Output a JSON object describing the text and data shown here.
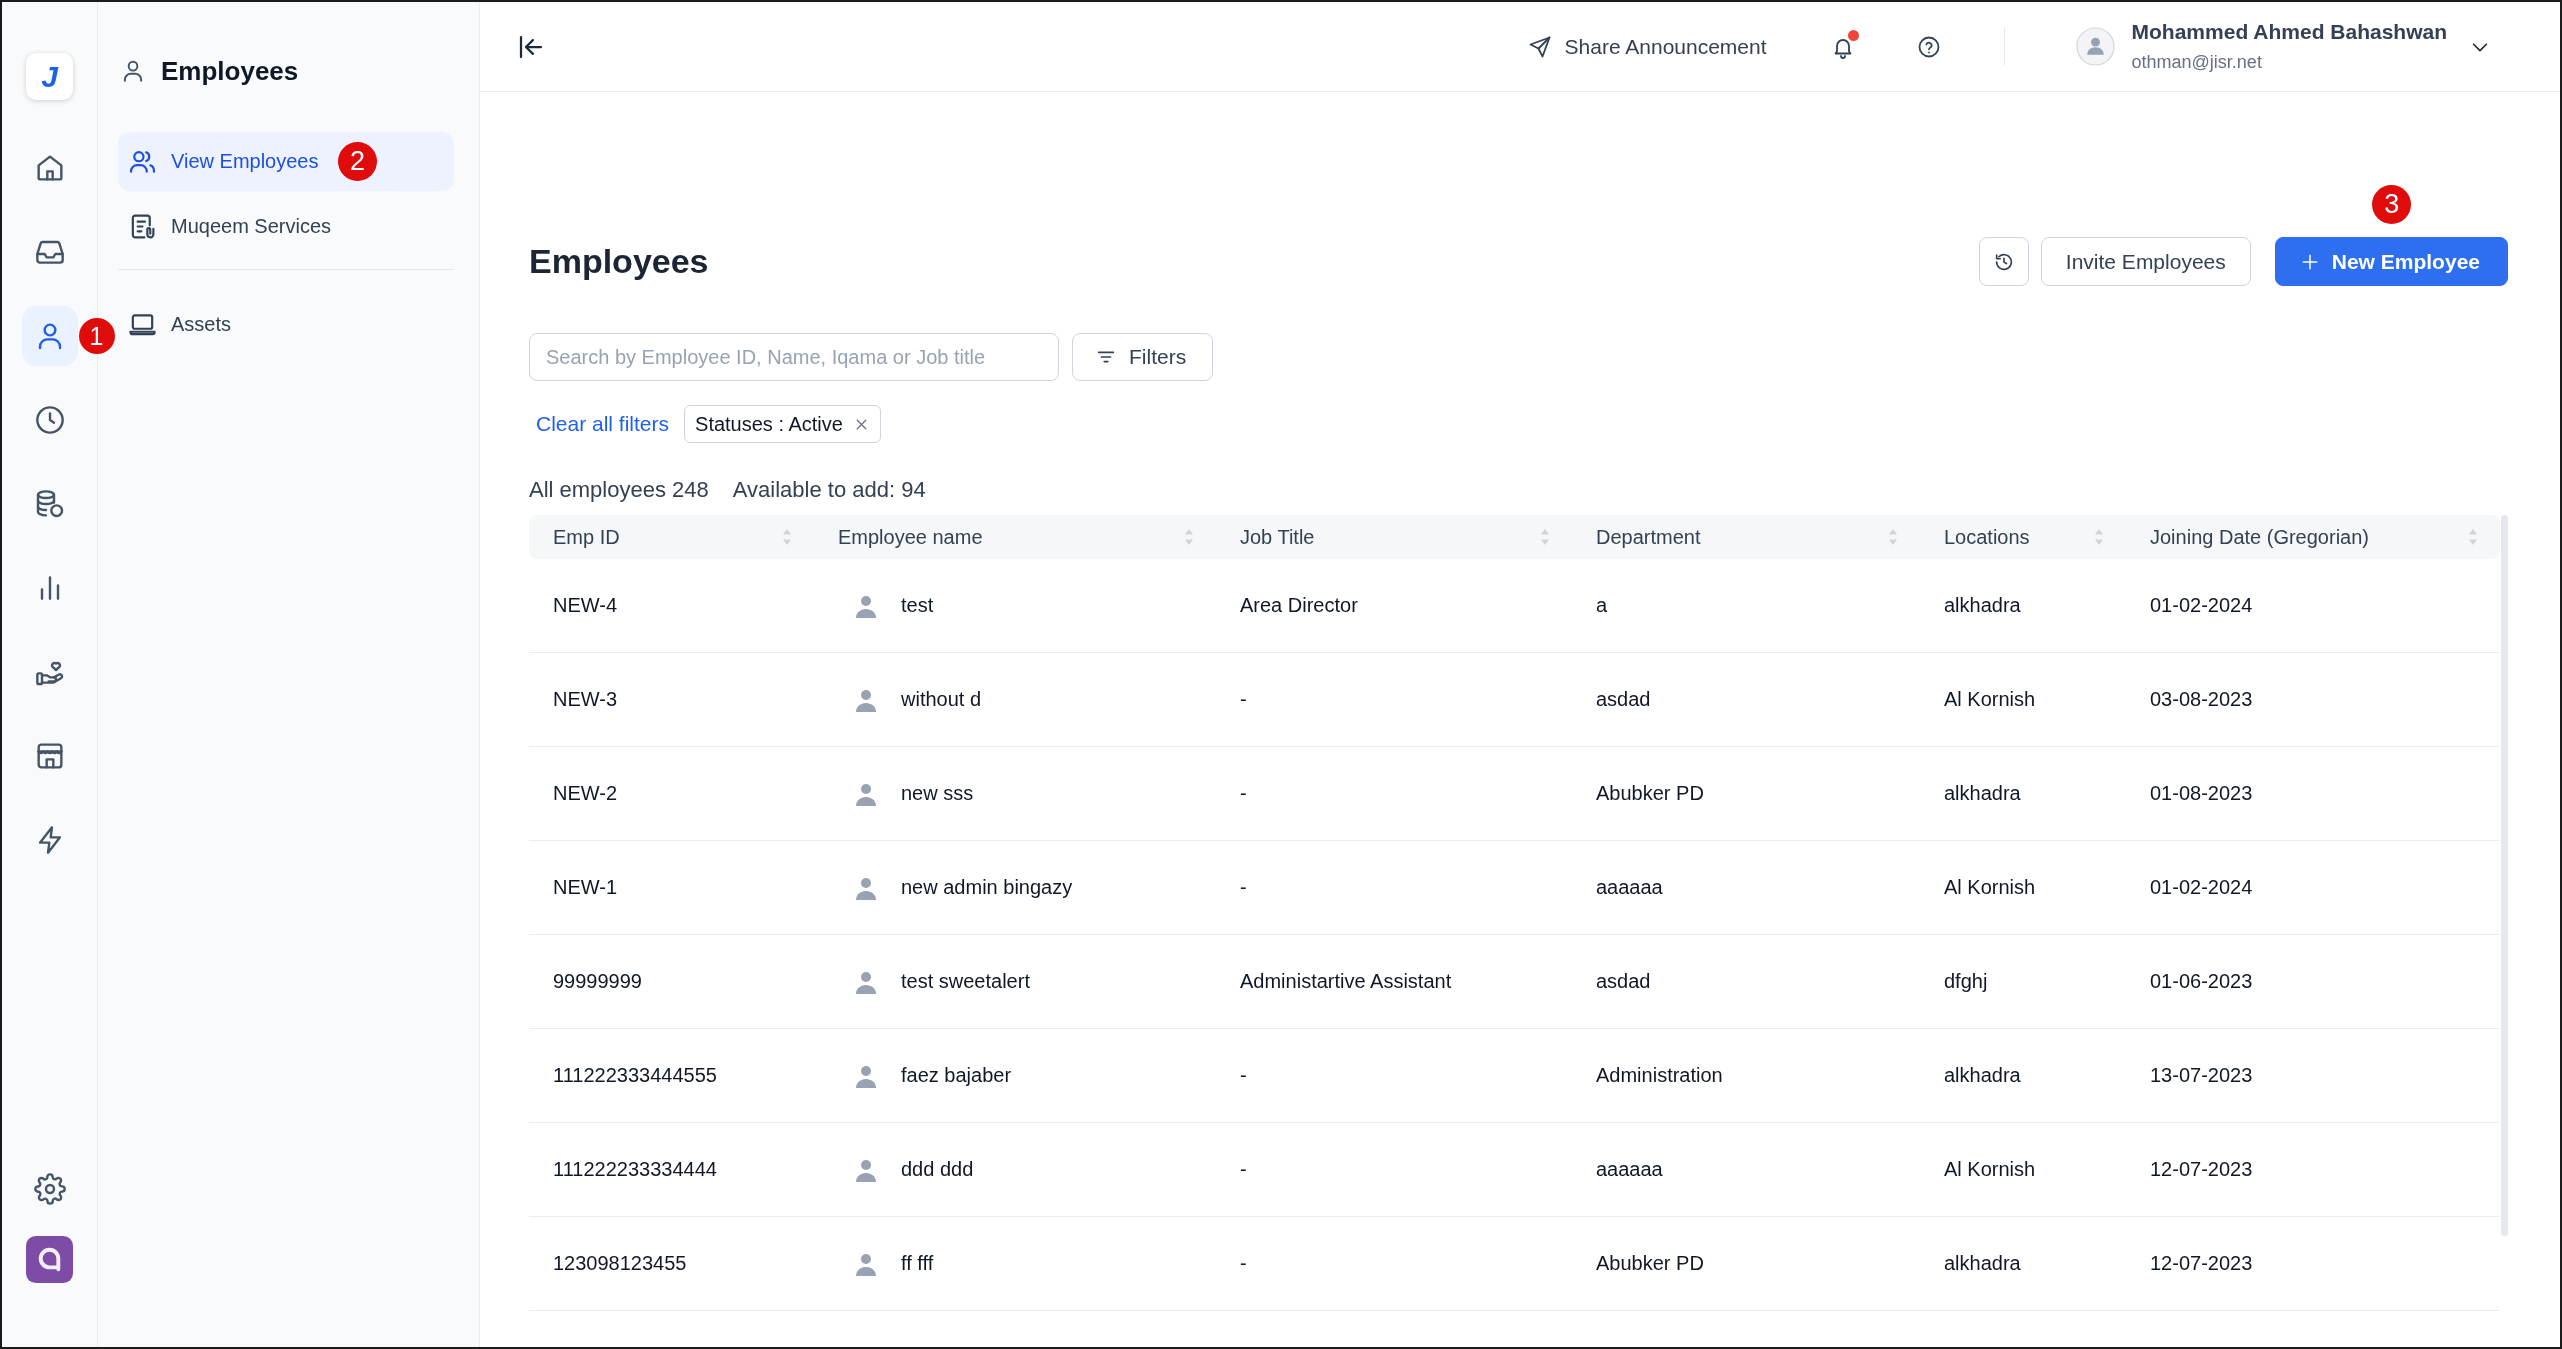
{
  "rail": {
    "logo": "J",
    "items": [
      {
        "kind": "home",
        "selected": false
      },
      {
        "kind": "inbox",
        "selected": false
      },
      {
        "kind": "employees",
        "selected": true,
        "marker": "1"
      },
      {
        "kind": "time",
        "selected": false
      },
      {
        "kind": "finance",
        "selected": false
      },
      {
        "kind": "reports",
        "selected": false
      },
      {
        "kind": "benefits",
        "selected": false
      },
      {
        "kind": "organization",
        "selected": false
      },
      {
        "kind": "automation",
        "selected": false
      }
    ],
    "bottom_items": [
      {
        "kind": "settings",
        "selected": false
      },
      {
        "kind": "app",
        "selected": false
      }
    ]
  },
  "sidebar": {
    "title": "Employees",
    "sections": [
      {
        "items": [
          {
            "kind": "people",
            "label": "View Employees",
            "selected": true,
            "marker": "2"
          },
          {
            "kind": "documents",
            "label": "Muqeem Services",
            "selected": false
          }
        ]
      },
      {
        "items": [
          {
            "kind": "laptop",
            "label": "Assets",
            "selected": false
          }
        ]
      }
    ]
  },
  "top_bar": {
    "share_button": "Share Announcement",
    "notifications": {
      "unread": true
    },
    "user": {
      "name": "Mohammed Ahmed Bahashwan",
      "email": "othman@jisr.net"
    }
  },
  "page": {
    "title": "Employees",
    "actions": [
      {
        "kind": "history"
      },
      {
        "kind": "invite",
        "label": "Invite Employees"
      },
      {
        "kind": "new",
        "label": "New Employee",
        "marker": "3"
      }
    ],
    "search": {
      "placeholder": "Search by Employee ID, Name, Iqama or Job title"
    },
    "filters_button": "Filters",
    "clear_filters": "Clear all filters",
    "chips": [
      {
        "label": "Statuses : Active"
      }
    ],
    "summary": [
      "All employees 248",
      "Available to add: 94"
    ]
  },
  "table": {
    "columns": [
      {
        "label": "Emp ID",
        "kind": "text",
        "sortable": true
      },
      {
        "label": "Employee name",
        "kind": "person",
        "sortable": true
      },
      {
        "label": "Job Title",
        "kind": "text",
        "sortable": true
      },
      {
        "label": "Department",
        "kind": "text",
        "sortable": true
      },
      {
        "label": "Locations",
        "kind": "text",
        "sortable": true
      },
      {
        "label": "Joining Date (Gregorian)",
        "kind": "text",
        "sortable": true
      }
    ],
    "rows": [
      [
        "NEW-4",
        "test",
        "Area Director",
        "a",
        "alkhadra",
        "01-02-2024"
      ],
      [
        "NEW-3",
        "without d",
        "-",
        "asdad",
        "Al Kornish",
        "03-08-2023"
      ],
      [
        "NEW-2",
        "new sss",
        "-",
        "Abubker PD",
        "alkhadra",
        "01-08-2023"
      ],
      [
        "NEW-1",
        "new admin bingazy",
        "-",
        "aaaaaa",
        "Al Kornish",
        "01-02-2024"
      ],
      [
        "99999999",
        "test sweetalert",
        "Administartive Assistant",
        "asdad",
        "dfghj",
        "01-06-2023"
      ],
      [
        "111222333444555",
        "faez bajaber",
        "-",
        "Administration",
        "alkhadra",
        "13-07-2023"
      ],
      [
        "111222233334444",
        "ddd ddd",
        "-",
        "aaaaaa",
        "Al Kornish",
        "12-07-2023"
      ],
      [
        "123098123455",
        "ff fff",
        "-",
        "Abubker PD",
        "alkhadra",
        "12-07-2023"
      ]
    ]
  }
}
